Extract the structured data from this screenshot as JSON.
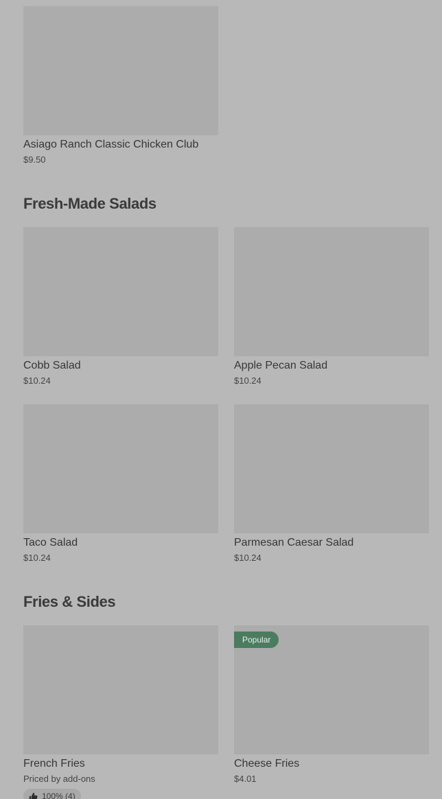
{
  "sections": {
    "salads": {
      "title": "Fresh-Made Salads"
    },
    "sides": {
      "title": "Fries & Sides"
    }
  },
  "items": {
    "asiago": {
      "name": "Asiago Ranch Classic Chicken Club",
      "price": "$9.50"
    },
    "cobb": {
      "name": "Cobb Salad",
      "price": "$10.24"
    },
    "apple_pecan": {
      "name": "Apple Pecan Salad",
      "price": "$10.24"
    },
    "taco": {
      "name": "Taco Salad",
      "price": "$10.24"
    },
    "caesar": {
      "name": "Parmesan Caesar Salad",
      "price": "$10.24"
    },
    "fries": {
      "name": "French Fries",
      "price": "Priced by add-ons",
      "rating": "100% (4)"
    },
    "cheese_fries": {
      "name": "Cheese Fries",
      "price": "$4.01",
      "badge": "Popular"
    }
  },
  "colors": {
    "overlay_background": "#b8b8b8",
    "image_placeholder": "#acacac",
    "badge_green": "#4b7c60"
  },
  "icons": {
    "rating": "thumbs-up-icon"
  }
}
